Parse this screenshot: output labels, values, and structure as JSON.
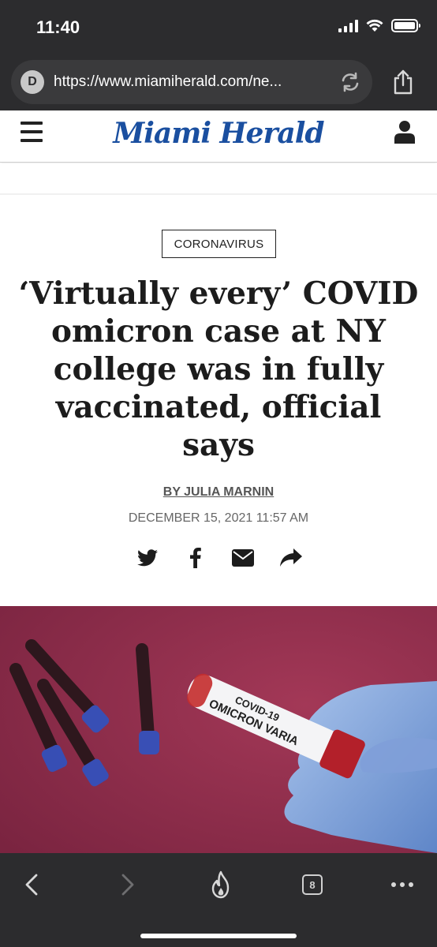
{
  "status_bar": {
    "time": "11:40"
  },
  "browser": {
    "site_badge": "D",
    "url": "https://www.miamiherald.com/ne..."
  },
  "site": {
    "brand": "Miami Herald"
  },
  "article": {
    "category": "CORONAVIRUS",
    "headline": "‘Virtually every’ COVID omicron case at NY college was in fully vaccinated, official says",
    "byline": "BY JULIA MARNIN",
    "date": "DECEMBER 15, 2021 11:57 AM",
    "share_icons": [
      "twitter-icon",
      "facebook-icon",
      "email-icon",
      "share-arrow-icon"
    ]
  },
  "hero_image": {
    "tube_label_line1": "COVID-19",
    "tube_label_line2": "OMICRON VARIA"
  },
  "toolbar": {
    "tab_count": "8"
  },
  "colors": {
    "brand_blue": "#1a4fa0",
    "chrome": "#2c2c2e",
    "hero_bg": "#8a2a48"
  }
}
